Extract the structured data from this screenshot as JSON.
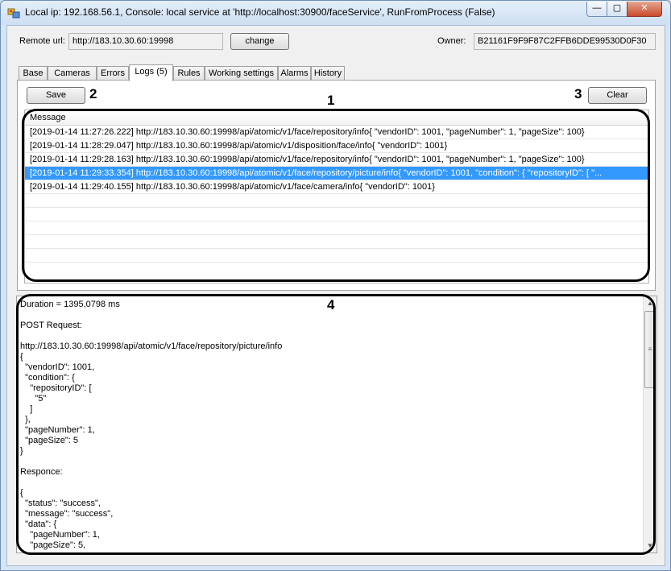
{
  "window": {
    "title": "Local ip: 192.168.56.1, Console: local service at 'http://localhost:30900/faceService', RunFromProcess (False)",
    "minimize": "—",
    "maximize": "▢",
    "close": "✕"
  },
  "header": {
    "remote_url_label": "Remote url:",
    "remote_url_value": "http://183.10.30.60:19998",
    "change_button": "change",
    "owner_label": "Owner:",
    "owner_value": "B21161F9F9F87C2FFB6DDE99530D0F30"
  },
  "tabs": [
    "Base",
    "Cameras",
    "Errors",
    "Logs (5)",
    "Rules",
    "Working settings",
    "Alarms",
    "History"
  ],
  "active_tab": 3,
  "logs": {
    "save_button": "Save",
    "clear_button": "Clear",
    "column_header": "Message",
    "rows": [
      "[2019-01-14 11:27:26.222] http://183.10.30.60:19998/api/atomic/v1/face/repository/info{  \"vendorID\": 1001,  \"pageNumber\": 1,  \"pageSize\": 100}",
      "[2019-01-14 11:28:29.047] http://183.10.30.60:19998/api/atomic/v1/disposition/face/info{  \"vendorID\": 1001}",
      "[2019-01-14 11:29:28.163] http://183.10.30.60:19998/api/atomic/v1/face/repository/info{  \"vendorID\": 1001,  \"pageNumber\": 1,  \"pageSize\": 100}",
      "[2019-01-14 11:29:33.354] http://183.10.30.60:19998/api/atomic/v1/face/repository/picture/info{  \"vendorID\": 1001,  \"condition\": {    \"repositoryID\": [     \"...",
      "[2019-01-14 11:29:40.155] http://183.10.30.60:19998/api/atomic/v1/face/camera/info{  \"vendorID\": 1001}"
    ],
    "selected_row": 3
  },
  "details": {
    "text": "Duration = 1395,0798 ms\n\nPOST Request:\n\nhttp://183.10.30.60:19998/api/atomic/v1/face/repository/picture/info\n{\n  \"vendorID\": 1001,\n  \"condition\": {\n    \"repositoryID\": [\n      \"5\"\n    ]\n  },\n  \"pageNumber\": 1,\n  \"pageSize\": 5\n}\n\nResponce:\n\n{\n  \"status\": \"success\",\n  \"message\": \"success\",\n  \"data\": {\n    \"pageNumber\": 1,\n    \"pageSize\": 5,"
  },
  "callouts": [
    "1",
    "2",
    "3",
    "4"
  ],
  "colors": {
    "selection": "#3399ff",
    "window_frame": "#d6e4f3"
  }
}
